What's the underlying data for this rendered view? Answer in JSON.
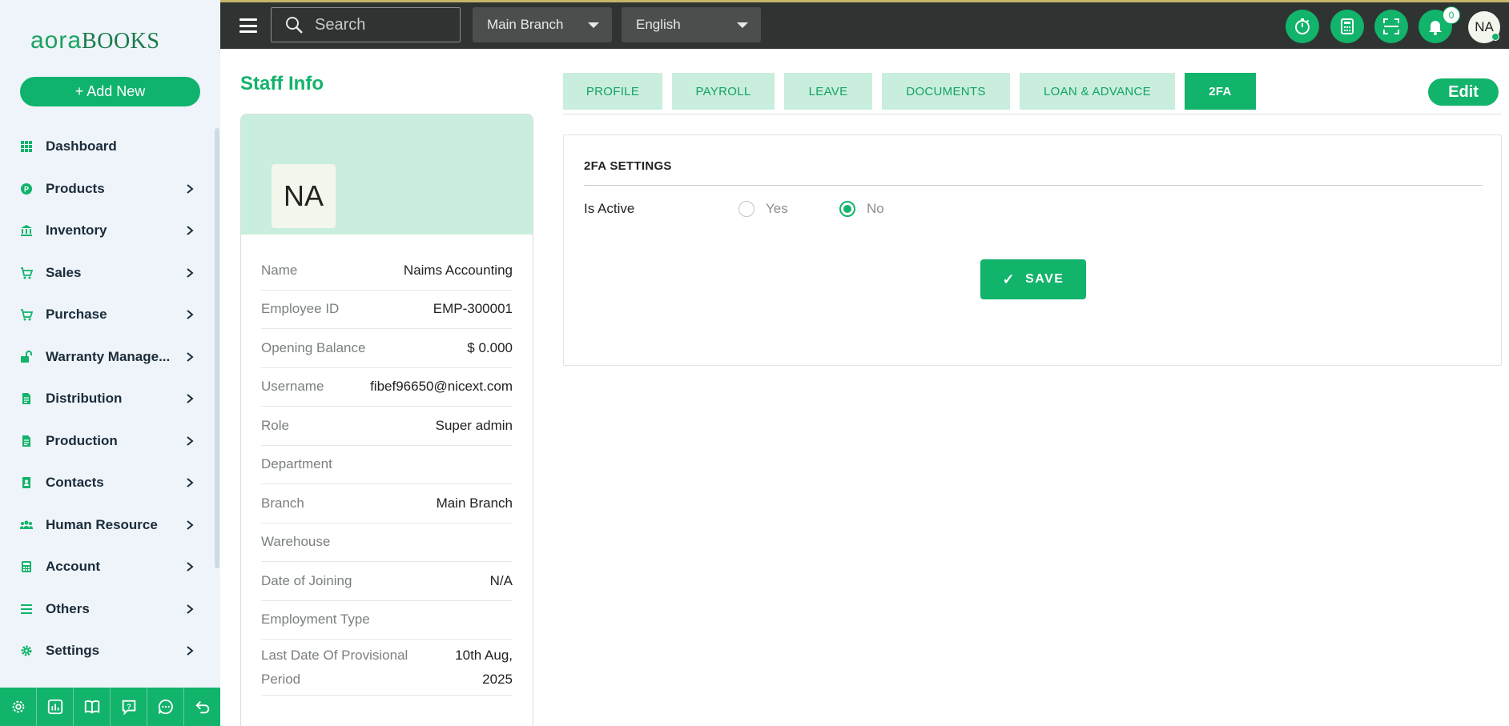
{
  "sidebar": {
    "logo_left": "aora",
    "logo_right": "BOOKS",
    "add_new_label": "+ Add New",
    "items": [
      {
        "label": "Dashboard",
        "icon": "dashboard-icon",
        "has_chevron": false
      },
      {
        "label": "Products",
        "icon": "products-icon",
        "has_chevron": true
      },
      {
        "label": "Inventory",
        "icon": "inventory-icon",
        "has_chevron": true
      },
      {
        "label": "Sales",
        "icon": "cart-icon",
        "has_chevron": true
      },
      {
        "label": "Purchase",
        "icon": "cart-icon",
        "has_chevron": true
      },
      {
        "label": "Warranty Manage...",
        "icon": "unlock-icon",
        "has_chevron": true
      },
      {
        "label": "Distribution",
        "icon": "document-icon",
        "has_chevron": true
      },
      {
        "label": "Production",
        "icon": "document-icon",
        "has_chevron": true
      },
      {
        "label": "Contacts",
        "icon": "contact-book-icon",
        "has_chevron": true
      },
      {
        "label": "Human Resource",
        "icon": "users-icon",
        "has_chevron": true
      },
      {
        "label": "Account",
        "icon": "calculator-icon",
        "has_chevron": true
      },
      {
        "label": "Others",
        "icon": "list-icon",
        "has_chevron": true
      },
      {
        "label": "Settings",
        "icon": "gear-icon",
        "has_chevron": true
      }
    ],
    "bottom_icons": [
      "gear-icon",
      "chart-icon",
      "book-icon",
      "help-icon",
      "chat-icon",
      "back-icon"
    ]
  },
  "topbar": {
    "search_placeholder": "Search",
    "branch_select": "Main Branch",
    "language_select": "English",
    "notification_count": "0",
    "avatar_initials": "NA"
  },
  "main": {
    "page_title": "Staff Info",
    "profile_initials": "NA",
    "info": [
      {
        "key": "Name",
        "value": "Naims Accounting"
      },
      {
        "key": "Employee ID",
        "value": "EMP-300001"
      },
      {
        "key": "Opening Balance",
        "value": "$ 0.000"
      },
      {
        "key": "Username",
        "value": "fibef96650@nicext.com"
      },
      {
        "key": "Role",
        "value": "Super admin"
      },
      {
        "key": "Department",
        "value": ""
      },
      {
        "key": "Branch",
        "value": "Main Branch"
      },
      {
        "key": "Warehouse",
        "value": ""
      },
      {
        "key": "Date of Joining",
        "value": "N/A"
      },
      {
        "key": "Employment Type",
        "value": ""
      }
    ],
    "last_provision": {
      "key_line1": "Last Date Of Provisional",
      "key_line2": "Period",
      "value_line1": "10th Aug,",
      "value_line2": "2025"
    },
    "tabs": [
      "PROFILE",
      "PAYROLL",
      "LEAVE",
      "DOCUMENTS",
      "LOAN & ADVANCE",
      "2FA"
    ],
    "active_tab": "2FA",
    "edit_label": "Edit",
    "panel": {
      "title": "2FA SETTINGS",
      "field_label": "Is Active",
      "option_yes": "Yes",
      "option_no": "No",
      "selected": "No",
      "save_check": "✓",
      "save_label": "SAVE"
    }
  },
  "colors": {
    "accent": "#12b36b",
    "tab_bg": "#c9eedd",
    "topbar_bg": "#2f3332",
    "sidebar_bg": "#eef4f9"
  }
}
